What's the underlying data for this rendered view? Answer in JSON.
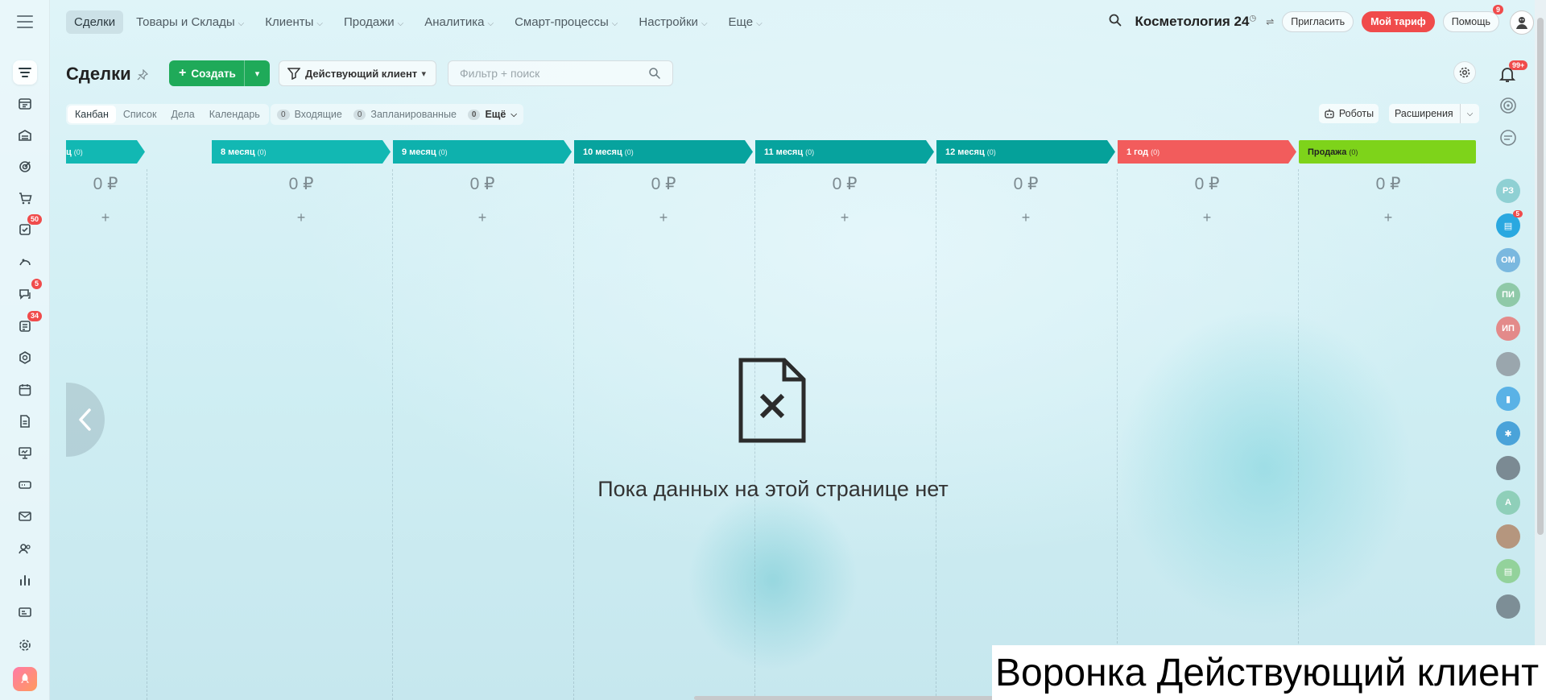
{
  "nav": {
    "items": [
      {
        "label": "Сделки",
        "active": true,
        "caret": false
      },
      {
        "label": "Товары и Склады",
        "caret": true
      },
      {
        "label": "Клиенты",
        "caret": true
      },
      {
        "label": "Продажи",
        "caret": true
      },
      {
        "label": "Аналитика",
        "caret": true
      },
      {
        "label": "Смарт-процессы",
        "caret": true
      },
      {
        "label": "Настройки",
        "caret": true
      },
      {
        "label": "Еще",
        "caret": true
      }
    ],
    "portal_name": "Косметология 24",
    "invite_label": "Пригласить",
    "tariff_label": "Мой тариф",
    "help_label": "Помощь",
    "help_badge": "9"
  },
  "sidebar": {
    "badges": {
      "tasks": "50",
      "chat": "5",
      "feed": "34"
    }
  },
  "page": {
    "title": "Сделки",
    "create_label": "Создать",
    "funnel_label": "Действующий клиент",
    "filter_placeholder": "Фильтр + поиск"
  },
  "views": {
    "tabs": [
      "Канбан",
      "Список",
      "Дела",
      "Календарь"
    ],
    "active_tab": "Канбан",
    "counters": [
      {
        "num": "0",
        "label": "Входящие"
      },
      {
        "num": "0",
        "label": "Запланированные"
      },
      {
        "num": "0",
        "label": "Ещё"
      }
    ],
    "robots_label": "Роботы",
    "extensions_label": "Расширения"
  },
  "stages": [
    {
      "name": "ц",
      "count": "(0)",
      "sum": "0 ₽",
      "color": "#12b8b3"
    },
    {
      "name": "8 месяц",
      "count": "(0)",
      "sum": "0 ₽",
      "color": "#12b8b3"
    },
    {
      "name": "9 месяц",
      "count": "(0)",
      "sum": "0 ₽",
      "color": "#0eb1ad"
    },
    {
      "name": "10 месяц",
      "count": "(0)",
      "sum": "0 ₽",
      "color": "#07a39e"
    },
    {
      "name": "11 месяц",
      "count": "(0)",
      "sum": "0 ₽",
      "color": "#07a39e"
    },
    {
      "name": "12 месяц",
      "count": "(0)",
      "sum": "0 ₽",
      "color": "#05a19a"
    },
    {
      "name": "1 год",
      "count": "(0)",
      "sum": "0 ₽",
      "color": "#f25c5c"
    },
    {
      "name": "Продажа",
      "count": "(0)",
      "sum": "0 ₽",
      "color": "#7ed31a"
    }
  ],
  "empty_state": {
    "text": "Пока данных на этой странице нет"
  },
  "notifications": {
    "badge": "99+"
  },
  "rail_avatars": [
    {
      "initials": "РЗ",
      "color": "#8fd0d3"
    },
    {
      "initials": "",
      "color": "#2aa8e0",
      "badge": "5"
    },
    {
      "initials": "ОМ",
      "color": "#7ab8df"
    },
    {
      "initials": "ПИ",
      "color": "#8fc9a8"
    },
    {
      "initials": "ИП",
      "color": "#e38a8a"
    },
    {
      "initials": "",
      "color": "#9aa6ad"
    },
    {
      "initials": "",
      "color": "#5ab2e6"
    },
    {
      "initials": "",
      "color": "#4aa3d9"
    },
    {
      "initials": "",
      "color": "#7b8a93"
    },
    {
      "initials": "А",
      "color": "#8fcfb9"
    },
    {
      "initials": "",
      "color": "#b5967e"
    },
    {
      "initials": "",
      "color": "#93d29b"
    },
    {
      "initials": "",
      "color": "#7d8e96"
    }
  ],
  "caption": "Воронка Действующий клиент"
}
